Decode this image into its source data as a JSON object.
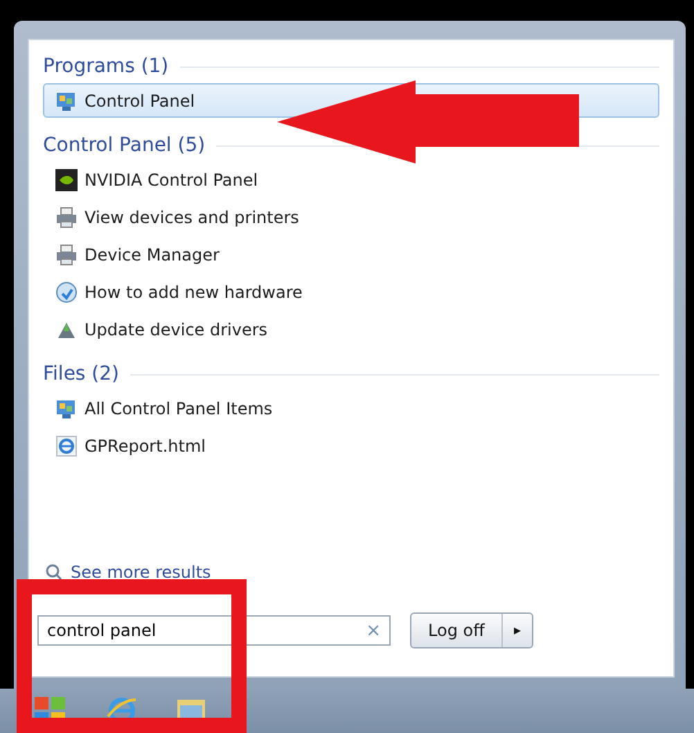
{
  "sections": [
    {
      "heading": "Programs (1)",
      "items": [
        {
          "label": "Control Panel",
          "kind": "control-panel",
          "selected": true
        }
      ]
    },
    {
      "heading": "Control Panel (5)",
      "items": [
        {
          "label": "NVIDIA Control Panel",
          "kind": "nvidia",
          "selected": false
        },
        {
          "label": "View devices and printers",
          "kind": "printer",
          "selected": false
        },
        {
          "label": "Device Manager",
          "kind": "printer",
          "selected": false
        },
        {
          "label": "How to add new hardware",
          "kind": "help",
          "selected": false
        },
        {
          "label": "Update device drivers",
          "kind": "drivers",
          "selected": false
        }
      ]
    },
    {
      "heading": "Files (2)",
      "items": [
        {
          "label": "All Control Panel Items",
          "kind": "control-panel",
          "selected": false
        },
        {
          "label": "GPReport.html",
          "kind": "browser",
          "selected": false
        }
      ]
    }
  ],
  "see_more": "See more results",
  "search": {
    "value": "control panel",
    "clear": "×"
  },
  "log_off": {
    "label": "Log off",
    "arrow": "▸"
  }
}
